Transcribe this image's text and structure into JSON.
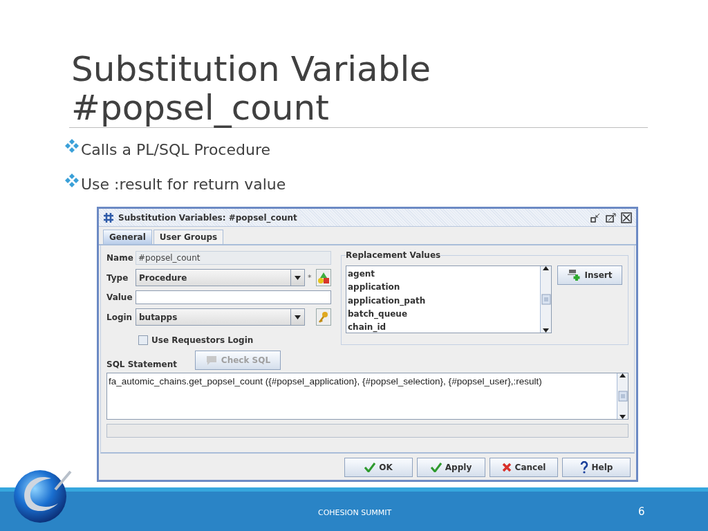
{
  "slide": {
    "title_lines": [
      "Substitution Variable",
      "#popsel_count"
    ],
    "bullets": [
      "Calls a PL/SQL Procedure",
      "Use :result for return value"
    ]
  },
  "dialog": {
    "title": "Substitution Variables: #popsel_count",
    "tabs": [
      {
        "label": "General",
        "selected": true
      },
      {
        "label": "User Groups",
        "selected": false
      }
    ],
    "name": {
      "label": "Name",
      "value": "#popsel_count"
    },
    "type": {
      "label": "Type",
      "value": "Procedure",
      "required_mark": "*"
    },
    "value": {
      "label": "Value"
    },
    "login": {
      "label": "Login",
      "value": "butapps"
    },
    "use_requestors_login": {
      "label": "Use Requestors Login",
      "checked": false
    },
    "sql_label": "SQL Statement",
    "check_sql": {
      "label": "Check SQL",
      "disabled": true
    },
    "sql_text": "fa_automic_chains.get_popsel_count ({#popsel_application}, {#popsel_selection}, {#popsel_user},:result)",
    "replacement_values": {
      "title": "Replacement Values",
      "items": [
        "agent",
        "application",
        "application_path",
        "batch_queue",
        "chain_id"
      ],
      "insert_label": "Insert"
    },
    "buttons": [
      {
        "label": "OK",
        "kind": "ok"
      },
      {
        "label": "Apply",
        "kind": "apply"
      },
      {
        "label": "Cancel",
        "kind": "cancel"
      },
      {
        "label": "Help",
        "kind": "help"
      }
    ]
  },
  "footer": {
    "text": "COHESION SUMMIT",
    "page": "6"
  }
}
